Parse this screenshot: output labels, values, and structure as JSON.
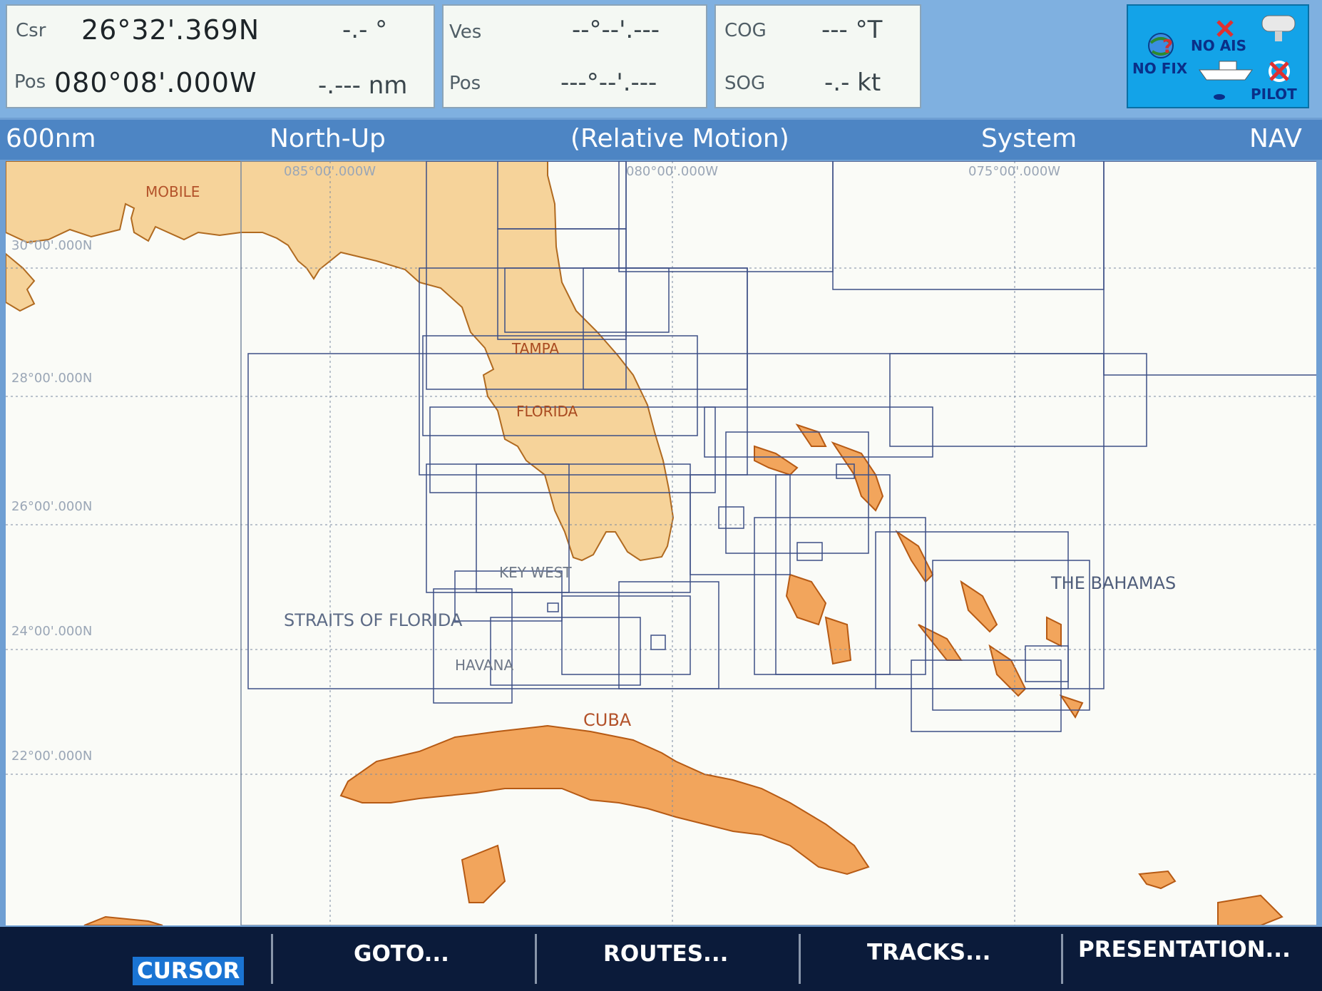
{
  "header": {
    "cursor": {
      "label_csr": "Csr",
      "lat": "26°32'.369N",
      "bearing": "-.- °",
      "label_pos": "Pos",
      "lon": "080°08'.000W",
      "range": "-.--- nm"
    },
    "vessel": {
      "label_ves": "Ves",
      "lat": "--°--'.---",
      "label_pos": "Pos",
      "lon": "---°--'.---"
    },
    "motion": {
      "label_cog": "COG",
      "cog": "--- °T",
      "label_sog": "SOG",
      "sog": "-.- kt"
    },
    "status": {
      "no_ais": "NO AIS",
      "no_fix": "NO FIX",
      "pilot": "PILOT"
    }
  },
  "mode_bar": {
    "range": "600nm",
    "orientation": "North-Up",
    "motion": "(Relative Motion)",
    "source": "System",
    "mode": "NAV"
  },
  "chart": {
    "lon_labels": [
      "085°00'.000W",
      "080°00'.000W",
      "075°00'.000W"
    ],
    "lat_labels": [
      "30°00'.000N",
      "28°00'.000N",
      "26°00'.000N",
      "24°00'.000N",
      "22°00'.000N"
    ],
    "place_names": {
      "mobile": "MOBILE",
      "tampa": "TAMPA",
      "florida": "FLORIDA",
      "key_west": "KEY WEST",
      "straits": "STRAITS OF FLORIDA",
      "havana": "HAVANA",
      "cuba": "CUBA",
      "bahamas": "THE BAHAMAS"
    },
    "colors": {
      "land_light": "#f6d39a",
      "land_dark": "#f2a55c",
      "water": "#fafbf7",
      "grid": "#7a8aa0",
      "chart_box": "#3d4f86"
    }
  },
  "softkeys": {
    "cursor": "CURSOR",
    "goto": "GOTO...",
    "routes": "ROUTES...",
    "tracks": "TRACKS...",
    "presentation": "PRESENTATION..."
  }
}
